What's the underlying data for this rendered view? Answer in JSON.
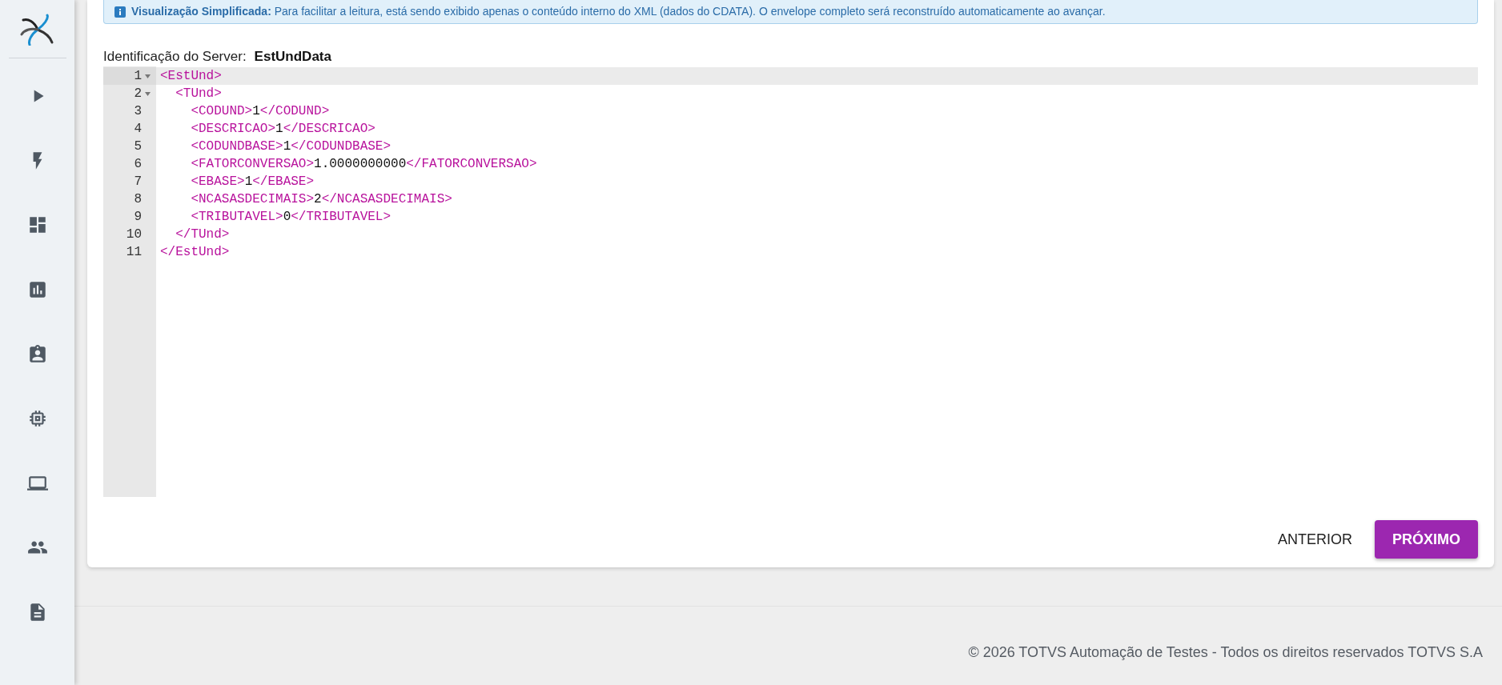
{
  "sidebar": {
    "items": [
      {
        "kind": "play"
      },
      {
        "kind": "bolt"
      },
      {
        "kind": "dashboard"
      },
      {
        "kind": "chart"
      },
      {
        "kind": "badge"
      },
      {
        "kind": "chip"
      },
      {
        "kind": "laptop"
      },
      {
        "kind": "people"
      },
      {
        "kind": "document"
      }
    ]
  },
  "banner": {
    "title": "Visualização Simplificada:",
    "text": "Para facilitar a leitura, está sendo exibido apenas o conteúdo interno do XML (dados do CDATA). O envelope completo será reconstruído automaticamente ao avançar."
  },
  "server": {
    "label": "Identificação do Server:",
    "value": "EstUndData"
  },
  "editor": {
    "lines": [
      {
        "number": "1",
        "code": "<EstUnd>",
        "foldable": true,
        "active": true
      },
      {
        "number": "2",
        "code": "  <TUnd>",
        "foldable": true,
        "active": false
      },
      {
        "number": "3",
        "code": "    <CODUND>1</CODUND>",
        "foldable": false,
        "active": false
      },
      {
        "number": "4",
        "code": "    <DESCRICAO>1</DESCRICAO>",
        "foldable": false,
        "active": false
      },
      {
        "number": "5",
        "code": "    <CODUNDBASE>1</CODUNDBASE>",
        "foldable": false,
        "active": false
      },
      {
        "number": "6",
        "code": "    <FATORCONVERSAO>1.0000000000</FATORCONVERSAO>",
        "foldable": false,
        "active": false
      },
      {
        "number": "7",
        "code": "    <EBASE>1</EBASE>",
        "foldable": false,
        "active": false
      },
      {
        "number": "8",
        "code": "    <NCASASDECIMAIS>2</NCASASDECIMAIS>",
        "foldable": false,
        "active": false
      },
      {
        "number": "9",
        "code": "    <TRIBUTAVEL>0</TRIBUTAVEL>",
        "foldable": false,
        "active": false
      },
      {
        "number": "10",
        "code": "  </TUnd>",
        "foldable": false,
        "active": false
      },
      {
        "number": "11",
        "code": "</EstUnd>",
        "foldable": false,
        "active": false
      }
    ]
  },
  "buttons": [
    {
      "label": "ANTERIOR",
      "kind": "text"
    },
    {
      "label": "PRÓXIMO",
      "kind": "primary"
    }
  ],
  "footer": "© 2026 TOTVS Automação de Testes - Todos os direitos reservados TOTVS S.A"
}
